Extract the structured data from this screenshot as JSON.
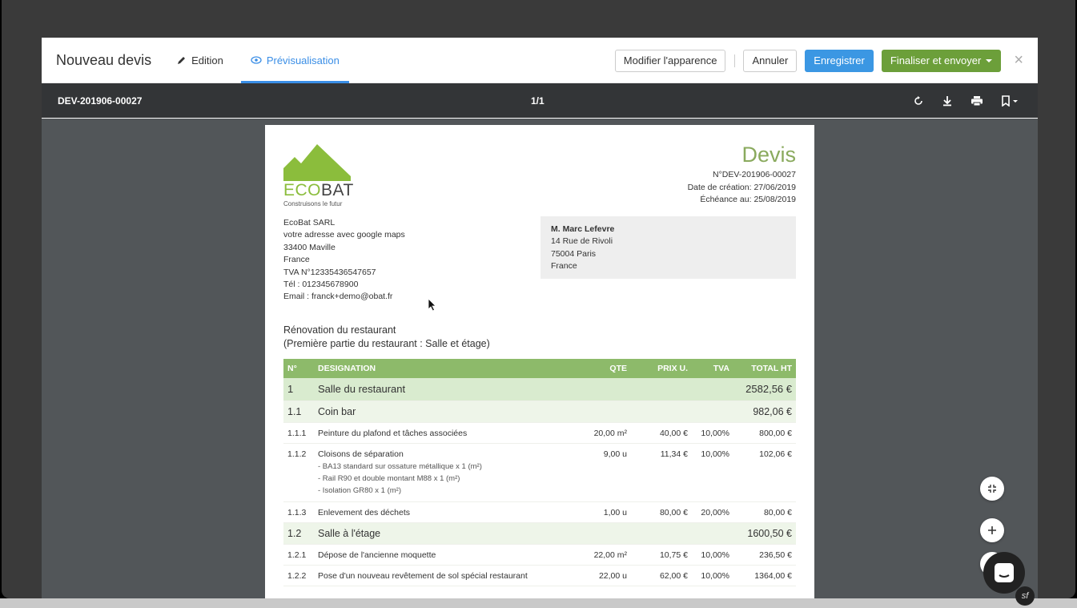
{
  "header": {
    "title": "Nouveau devis",
    "tab_edition": "Edition",
    "tab_preview": "Prévisualisation",
    "btn_appearance": "Modifier l'apparence",
    "btn_cancel": "Annuler",
    "btn_save": "Enregistrer",
    "btn_finalize": "Finaliser et envoyer",
    "close": "×"
  },
  "toolbar": {
    "doc_id": "DEV-201906-00027",
    "page_count": "1/1"
  },
  "document": {
    "brand_eco": "ECO",
    "brand_bat": "BAT",
    "tagline": "Construisons le futur",
    "title": "Devis",
    "number": "N°DEV-201906-00027",
    "created": "Date de création: 27/06/2019",
    "due": "Échéance au: 25/08/2019",
    "sender": [
      "EcoBat SARL",
      "votre adresse avec google maps",
      "33400 Maville",
      "France",
      "TVA N°12335436547657",
      "Tél : 012345678900",
      "Email : franck+demo@obat.fr"
    ],
    "recipient_name": "M. Marc Lefevre",
    "recipient_lines": [
      "14 Rue de Rivoli",
      "75004 Paris",
      "France"
    ],
    "subject_1": "Rénovation du restaurant",
    "subject_2": "(Première partie du restaurant : Salle et étage)",
    "columns": [
      "N°",
      "DESIGNATION",
      "QTE",
      "PRIX U.",
      "TVA",
      "TOTAL HT"
    ],
    "rows": [
      {
        "n": "1",
        "label": "Salle du restaurant",
        "total": "2582,56 €"
      },
      {
        "n": "1.1",
        "label": "Coin bar",
        "total": "982,06 €"
      },
      {
        "n": "1.1.1",
        "label": "Peinture du plafond et tâches associées",
        "qte": "20,00 m²",
        "pu": "40,00 €",
        "tva": "10,00%",
        "total": "800,00 €"
      },
      {
        "n": "1.1.2",
        "label": "Cloisons de séparation",
        "qte": "9,00 u",
        "pu": "11,34 €",
        "tva": "10,00%",
        "total": "102,06 €",
        "sub": [
          "- BA13 standard sur ossature métallique x 1 (m²)",
          "- Rail R90 et double montant M88 x 1 (m²)",
          "- Isolation GR80 x 1 (m²)"
        ]
      },
      {
        "n": "1.1.3",
        "label": "Enlevement des déchets",
        "qte": "1,00 u",
        "pu": "80,00 €",
        "tva": "20,00%",
        "total": "80,00 €"
      },
      {
        "n": "1.2",
        "label": "Salle à l'étage",
        "total": "1600,50 €"
      },
      {
        "n": "1.2.1",
        "label": "Dépose de l'ancienne moquette",
        "qte": "22,00 m²",
        "pu": "10,75 €",
        "tva": "10,00%",
        "total": "236,50 €"
      },
      {
        "n": "1.2.2",
        "label": "Pose d'un nouveau revêtement de sol spécial restaurant",
        "qte": "22,00 u",
        "pu": "62,00 €",
        "tva": "10,00%",
        "total": "1364,00 €"
      }
    ]
  },
  "colors": {
    "accent_blue": "#3b97e3",
    "accent_green": "#6c9f3a",
    "table_header": "#8dba6a",
    "brand_green": "#8bbd3c"
  },
  "badge_sf": "sf"
}
